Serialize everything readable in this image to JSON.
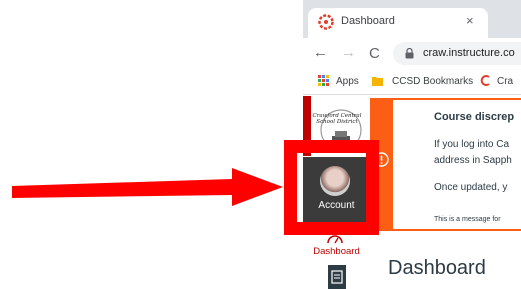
{
  "browser": {
    "tab_title": "Dashboard",
    "tab_close": "×",
    "url": "craw.instructure.co",
    "nav": {
      "back": "←",
      "forward": "→",
      "reload": "C"
    },
    "bookmarks": [
      {
        "label": "Apps",
        "icon": "apps-grid-icon"
      },
      {
        "label": "CCSD Bookmarks",
        "icon": "folder-icon"
      },
      {
        "label": "Cra",
        "icon": "canvas-logo-icon"
      }
    ]
  },
  "global_nav": {
    "logo_text": "Crawford Central School District",
    "account_label": "Account",
    "dashboard_label": "Dashboard"
  },
  "alert": {
    "title": "Course discrep",
    "line1": "If you log into Ca",
    "line2": "address in Sapph",
    "line3": "Once updated, y",
    "footer": "This is a message for"
  },
  "main": {
    "page_title": "Dashboard"
  },
  "colors": {
    "canvas_red": "#c00000",
    "alert_orange": "#fc5e13",
    "annotation_red": "#ff0000",
    "nav_dark": "#3b3b3b"
  }
}
